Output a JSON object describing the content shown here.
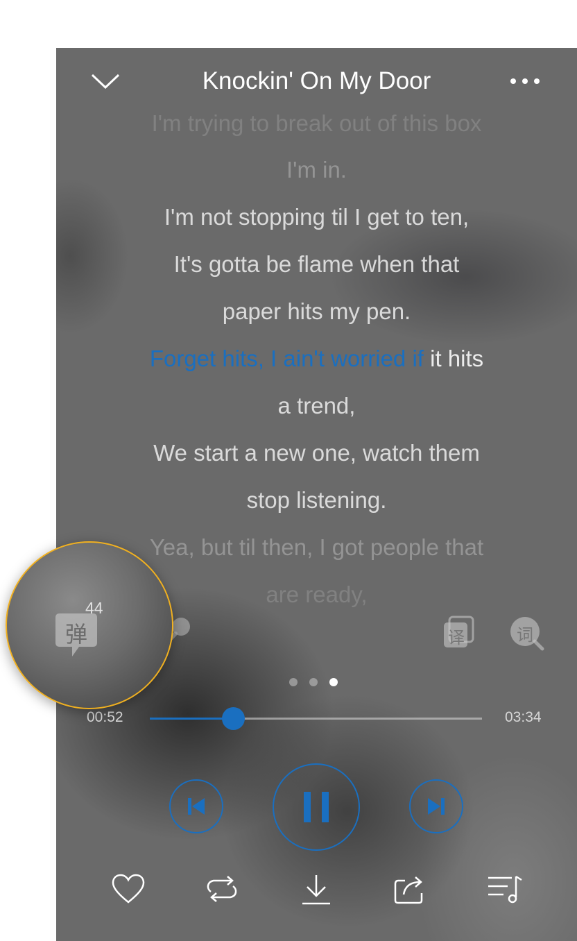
{
  "header": {
    "title": "Knockin' On My Door",
    "back_icon": "chevron-down-icon",
    "more_icon": "more-dots-icon"
  },
  "lyrics": {
    "lines": [
      {
        "text": "I'm trying to break out of this box",
        "state": "faded2"
      },
      {
        "text": "I'm in.",
        "state": "faded"
      },
      {
        "text": "I'm not stopping til I get to ten,",
        "state": "normal"
      },
      {
        "text": "It's gotta be flame when that",
        "state": "normal"
      },
      {
        "text": "paper hits my pen.",
        "state": "normal"
      },
      {
        "text": "a trend,",
        "state": "normal"
      },
      {
        "text": "We start a new one, watch them",
        "state": "normal"
      },
      {
        "text": "stop listening.",
        "state": "normal"
      },
      {
        "text": "Yea, but til then, I got people that",
        "state": "faded"
      },
      {
        "text": "are ready,",
        "state": "faded2"
      }
    ],
    "current_line": {
      "sung_part": "Forget hits, I ain't worried if",
      "remaining_part": " it hits"
    }
  },
  "tools": {
    "danmu_label": "弹",
    "danmu_count": "44",
    "danmu_icon": "danmu-bubble-icon",
    "mic_icon": "microphone-icon",
    "translate_label": "译",
    "translate_icon": "translate-icon",
    "lyric_search_label": "词",
    "lyric_search_icon": "lyric-search-icon"
  },
  "pager": {
    "count": 3,
    "active_index": 2
  },
  "progress": {
    "elapsed": "00:52",
    "total": "03:34",
    "fraction": 0.25
  },
  "controls": {
    "prev_icon": "skip-previous-icon",
    "play_pause_icon": "pause-icon",
    "next_icon": "skip-next-icon"
  },
  "bottom_bar": [
    {
      "icon": "heart-icon"
    },
    {
      "icon": "repeat-icon"
    },
    {
      "icon": "download-icon"
    },
    {
      "icon": "share-icon"
    },
    {
      "icon": "playlist-icon"
    }
  ],
  "colors": {
    "accent": "#1a6fc0",
    "highlight_ring": "#f0b020"
  }
}
